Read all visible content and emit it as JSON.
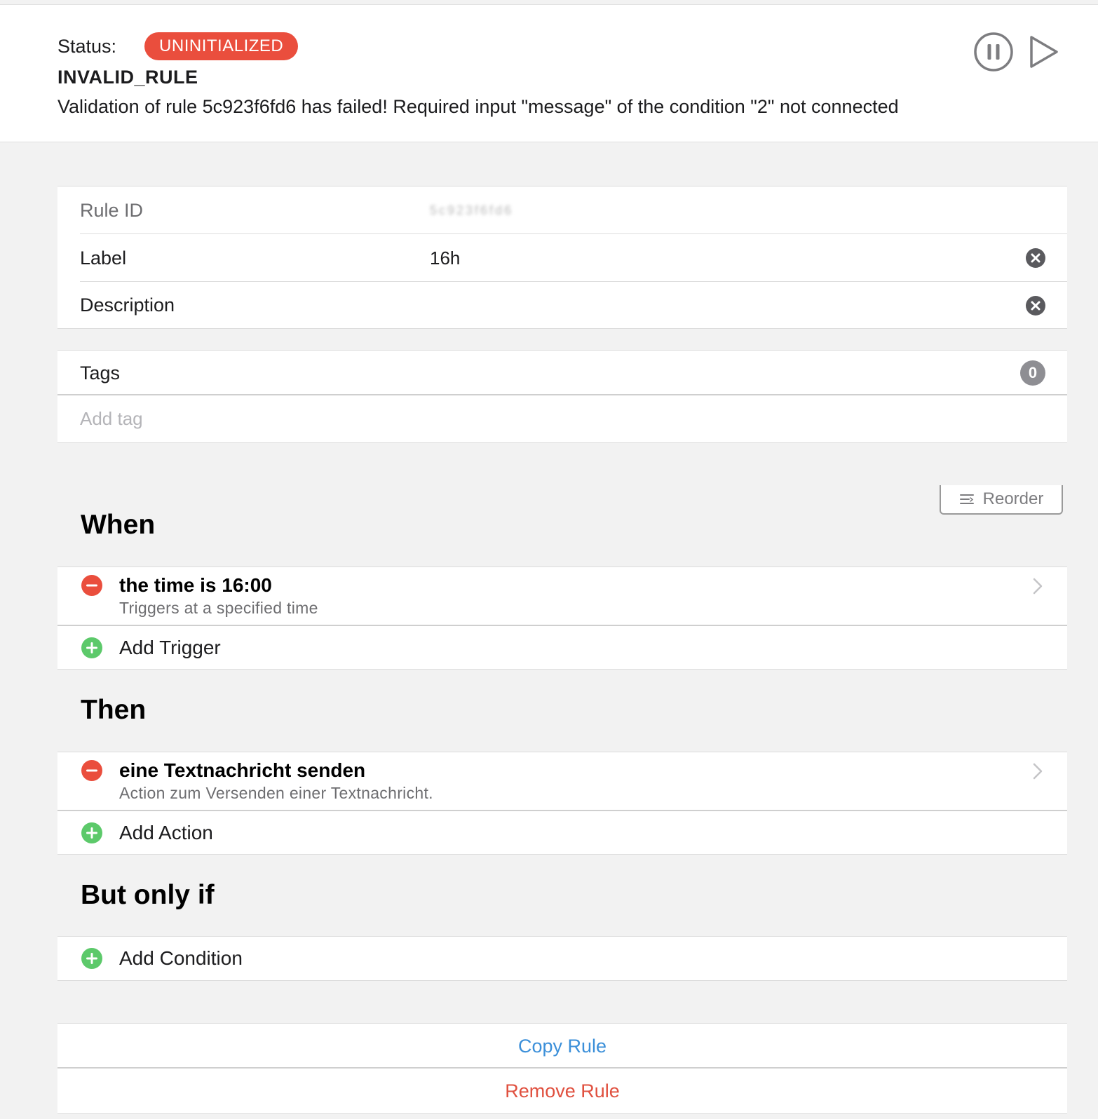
{
  "header": {
    "status_label": "Status:",
    "status_value": "UNINITIALIZED",
    "status_code": "INVALID_RULE",
    "status_message": "Validation of rule 5c923f6fd6 has failed! Required input \"message\" of the condition \"2\" not connected",
    "pause_icon": "pause-circle-icon",
    "run_icon": "play-icon"
  },
  "details": {
    "rule_id_label": "Rule ID",
    "rule_id_value": "5c923f6fd6",
    "label_label": "Label",
    "label_value": "16h",
    "description_label": "Description",
    "description_value": "",
    "clear_icon": "clear-circle-icon"
  },
  "tags": {
    "label": "Tags",
    "count": "0",
    "add_placeholder": "Add tag"
  },
  "reorder": {
    "label": "Reorder",
    "icon": "reorder-lines-icon"
  },
  "when": {
    "title": "When",
    "items": [
      {
        "title": "the time is 16:00",
        "subtitle": "Triggers at a specified time"
      }
    ],
    "add_label": "Add Trigger"
  },
  "then": {
    "title": "Then",
    "items": [
      {
        "title": "eine Textnachricht senden",
        "subtitle": "Action zum Versenden einer Textnachricht."
      }
    ],
    "add_label": "Add Action"
  },
  "but_only_if": {
    "title": "But only if",
    "add_label": "Add Condition"
  },
  "actions": {
    "copy_label": "Copy Rule",
    "remove_label": "Remove Rule"
  },
  "colors": {
    "badge_red": "#ea4e3d",
    "remove_red": "#ea4e3d",
    "add_green": "#5cc96a",
    "link_blue": "#3b8fd9",
    "destructive_red": "#e0503f"
  }
}
